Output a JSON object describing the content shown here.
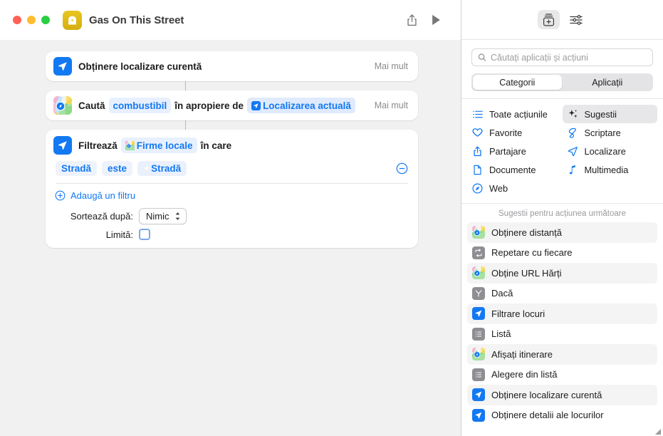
{
  "window": {
    "title": "Gas On This Street",
    "app_icon": "gas-pump-icon"
  },
  "toolbar": {
    "share_label": "share-icon",
    "play_label": "play-icon"
  },
  "workflow": {
    "actions": [
      {
        "id": "get-current-location",
        "icon": "location-arrow-icon",
        "title": "Obținere localizare curentă",
        "more_label": "Mai mult"
      },
      {
        "id": "search-local-businesses",
        "icon": "maps-icon",
        "word1": "Caută",
        "token1": "combustibil",
        "word2": "în apropiere de",
        "token2": "Localizarea actuală",
        "more_label": "Mai mult"
      },
      {
        "id": "filter-places",
        "icon": "location-arrow-icon",
        "word1": "Filtrează",
        "token1": "Firme locale",
        "word2": "în care",
        "condition": {
          "field": "Stradă",
          "operator": "este",
          "value": "Stradă"
        },
        "add_filter_label": "Adaugă un filtru",
        "sort_label": "Sortează după:",
        "sort_value": "Nimic",
        "limit_label": "Limită:",
        "limit_checked": false
      }
    ]
  },
  "sidebar": {
    "top_buttons": [
      {
        "name": "action-library-icon",
        "active": true
      },
      {
        "name": "sliders-icon",
        "active": false
      }
    ],
    "search": {
      "placeholder": "Căutați aplicații și acțiuni",
      "value": "",
      "icon": "search-icon"
    },
    "segments": [
      {
        "label": "Categorii",
        "active": true
      },
      {
        "label": "Aplicații",
        "active": false
      }
    ],
    "categories": [
      {
        "label": "Toate acțiunile",
        "icon": "list-bullet-icon",
        "selected": false
      },
      {
        "label": "Sugestii",
        "icon": "sparkles-icon",
        "selected": true
      },
      {
        "label": "Favorite",
        "icon": "heart-icon",
        "selected": false
      },
      {
        "label": "Scriptare",
        "icon": "script-icon",
        "selected": false
      },
      {
        "label": "Partajare",
        "icon": "share-icon",
        "selected": false
      },
      {
        "label": "Localizare",
        "icon": "location-arrow-icon",
        "selected": false
      },
      {
        "label": "Documente",
        "icon": "document-icon",
        "selected": false
      },
      {
        "label": "Multimedia",
        "icon": "music-note-icon",
        "selected": false
      },
      {
        "label": "Web",
        "icon": "safari-compass-icon",
        "selected": false
      }
    ],
    "suggestions_header": "Sugestii pentru acțiunea următoare",
    "suggestions": [
      {
        "label": "Obținere distanță",
        "icon": "maps-icon",
        "alt": true
      },
      {
        "label": "Repetare cu fiecare",
        "icon": "repeat-icon",
        "alt": false
      },
      {
        "label": "Obține URL Hărți",
        "icon": "maps-icon",
        "alt": true
      },
      {
        "label": "Dacă",
        "icon": "branch-icon",
        "alt": false
      },
      {
        "label": "Filtrare locuri",
        "icon": "location-arrow-icon",
        "alt": true
      },
      {
        "label": "Listă",
        "icon": "list-icon",
        "alt": false
      },
      {
        "label": "Afișați itinerare",
        "icon": "maps-icon",
        "alt": true
      },
      {
        "label": "Alegere din listă",
        "icon": "list-icon",
        "alt": false
      },
      {
        "label": "Obținere localizare curentă",
        "icon": "location-arrow-icon",
        "alt": true
      },
      {
        "label": "Obținere detalii ale locurilor",
        "icon": "location-arrow-icon",
        "alt": false
      }
    ]
  },
  "colors": {
    "accent_blue": "#1279f2",
    "token_bg": "#e8f0fe",
    "canvas_bg": "#f1f1f1",
    "app_icon_yellow": "#dcb715"
  }
}
